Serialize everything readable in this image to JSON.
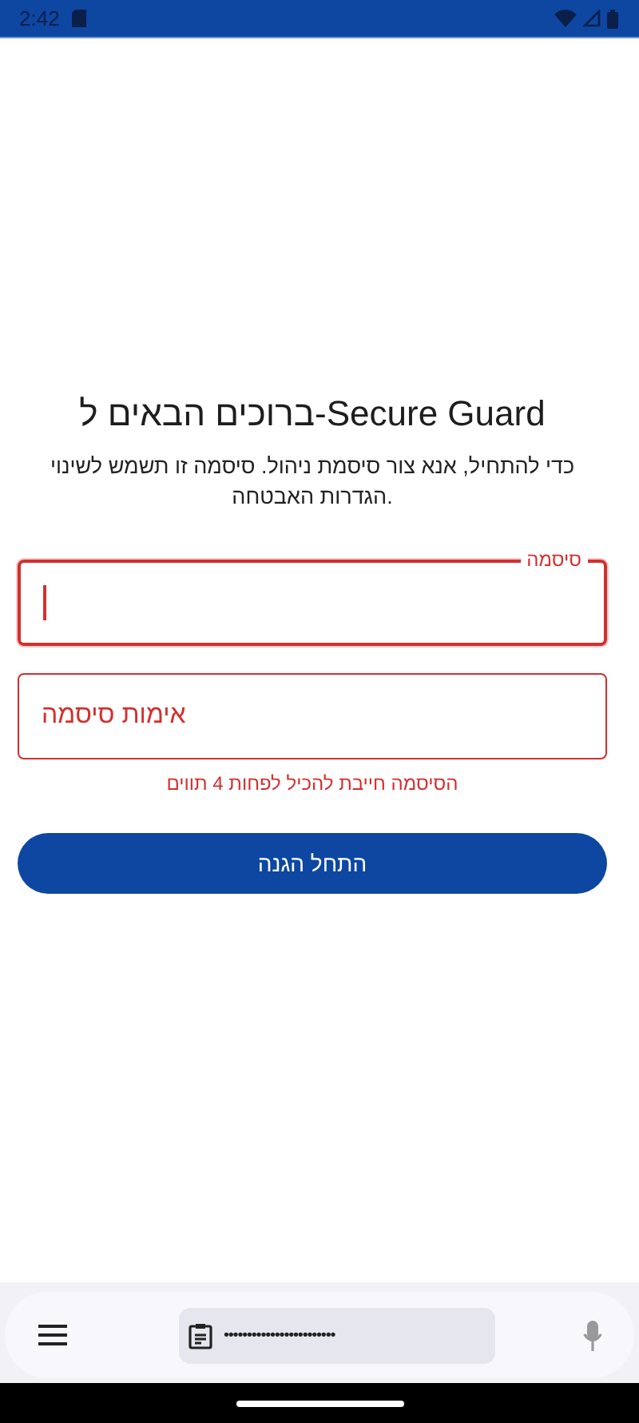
{
  "status_bar": {
    "time": "2:42"
  },
  "title": "ברוכים הבאים ל-Secure Guard",
  "subtitle": "כדי להתחיל, אנא צור סיסמת ניהול. סיסמה זו תשמש לשינוי הגדרות האבטחה.",
  "fields": [
    {
      "label": "סיסמה",
      "focused": true,
      "error": true
    },
    {
      "placeholder": "אימות סיסמה",
      "focused": false,
      "error": true
    }
  ],
  "error_text": "הסיסמה חייבת להכיל לפחות 4 תווים",
  "button": "התחל הגנה",
  "keyboard_bar": {
    "clipboard": "••••••••••••••••••••••••"
  }
}
